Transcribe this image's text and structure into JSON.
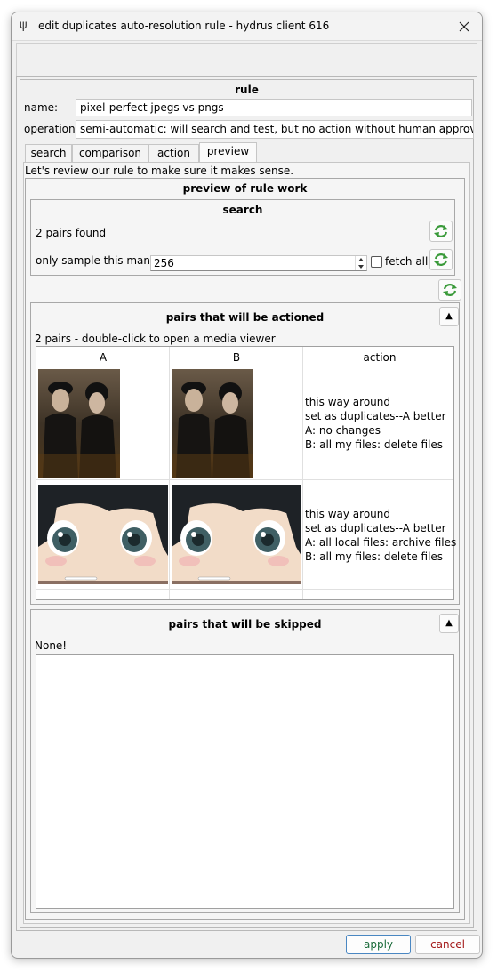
{
  "window": {
    "title": "edit duplicates auto-resolution rule - hydrus client 616",
    "app_icon": "psi-icon"
  },
  "rule": {
    "heading": "rule",
    "name_label": "name:",
    "name_value": "pixel-perfect jpegs vs pngs",
    "operation_label": "operation:",
    "operation_value": "semi-automatic: will search and test, but no action without human approval"
  },
  "tabs": [
    {
      "label": "search"
    },
    {
      "label": "comparison"
    },
    {
      "label": "action"
    },
    {
      "label": "preview"
    }
  ],
  "preview": {
    "intro": "Let's review our rule to make sure it makes sense.",
    "group_title": "preview of rule work",
    "search": {
      "title": "search",
      "found_text": "2 pairs found",
      "sample_label": "only sample this many:",
      "sample_value": "256",
      "fetch_all_label": "fetch all"
    },
    "actioned": {
      "title": "pairs that will be actioned",
      "info": "2 pairs - double-click to open a media viewer",
      "columns": [
        "A",
        "B",
        "action"
      ],
      "rows": [
        {
          "action_lines": [
            "this way around",
            "set as duplicates--A better",
            "A: no changes",
            "B: all my files: delete files"
          ]
        },
        {
          "action_lines": [
            "this way around",
            "set as duplicates--A better",
            "A: all local files: archive files",
            "B: all my files: delete files"
          ]
        }
      ]
    },
    "skipped": {
      "title": "pairs that will be skipped",
      "info": "None!"
    }
  },
  "buttons": {
    "apply": "apply",
    "cancel": "cancel"
  },
  "colors": {
    "apply_text": "#1a6b3a",
    "cancel_text": "#a21616",
    "refresh_icon": "#3a9a3a"
  }
}
